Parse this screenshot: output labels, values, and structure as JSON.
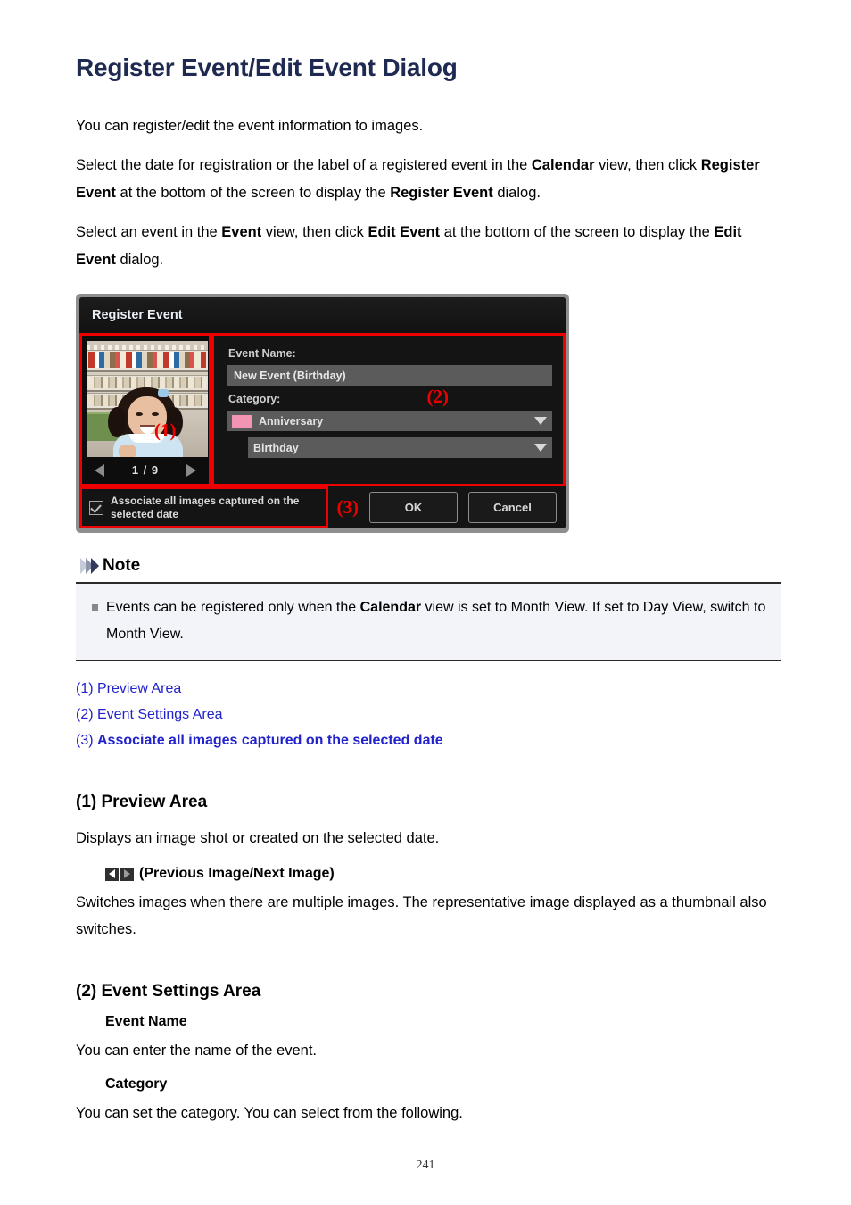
{
  "page": {
    "title": "Register Event/Edit Event Dialog",
    "page_number": "241",
    "title_color": "#1f2a52",
    "link_color": "#2222cc",
    "annotation_color": "#ee0000"
  },
  "intro": {
    "p1": "You can register/edit the event information to images.",
    "p2_a": "Select the date for registration or the label of a registered event in the ",
    "p2_b": "Calendar",
    "p2_c": " view, then click ",
    "p2_d": "Register Event",
    "p2_e": " at the bottom of the screen to display the ",
    "p2_f": "Register Event",
    "p2_g": " dialog.",
    "p3_a": "Select an event in the ",
    "p3_b": "Event",
    "p3_c": " view, then click ",
    "p3_d": "Edit Event",
    "p3_e": " at the bottom of the screen to display the ",
    "p3_f": "Edit Event",
    "p3_g": " dialog."
  },
  "dialog": {
    "title": "Register Event",
    "preview": {
      "annotation": "(1)",
      "counter": "1 / 9",
      "prev_icon": "left-triangle-icon",
      "next_icon": "right-triangle-icon"
    },
    "settings": {
      "annotation": "(2)",
      "event_name_label": "Event Name:",
      "event_name_value": "New Event (Birthday)",
      "category_label": "Category:",
      "category_value": "Anniversary",
      "category_swatch_color": "#f295b3",
      "subcategory_value": "Birthday",
      "caret_icon": "chevron-down-icon"
    },
    "footer": {
      "annotation": "(3)",
      "associate_label_line1": "Associate all images captured on the",
      "associate_label_line2": "selected date",
      "checkbox_state": "checked",
      "ok_label": "OK",
      "cancel_label": "Cancel"
    }
  },
  "note": {
    "heading": "Note",
    "chevron_icon": "triple-chevron-icon",
    "item_a": "Events can be registered only when the ",
    "item_b": "Calendar",
    "item_c": " view is set to Month View. If set to Day View, switch to Month View."
  },
  "links": [
    {
      "num": "(1) ",
      "label": "Preview Area",
      "bold": false
    },
    {
      "num": "(2) ",
      "label": "Event Settings Area",
      "bold": false
    },
    {
      "num": "(3) ",
      "label": "Associate all images captured on the selected date",
      "bold": true
    }
  ],
  "section1": {
    "heading": "(1) Preview Area",
    "body": "Displays an image shot or created on the selected date.",
    "arrow_caption": "(Previous Image/Next Image)",
    "prev_icon": "previous-image-icon",
    "next_icon": "next-image-icon",
    "detail": "Switches images when there are multiple images. The representative image displayed as a thumbnail also switches."
  },
  "section2": {
    "heading": "(2) Event Settings Area",
    "sub1_heading": "Event Name",
    "sub1_body": "You can enter the name of the event.",
    "sub2_heading": "Category",
    "sub2_body": "You can set the category. You can select from the following."
  }
}
